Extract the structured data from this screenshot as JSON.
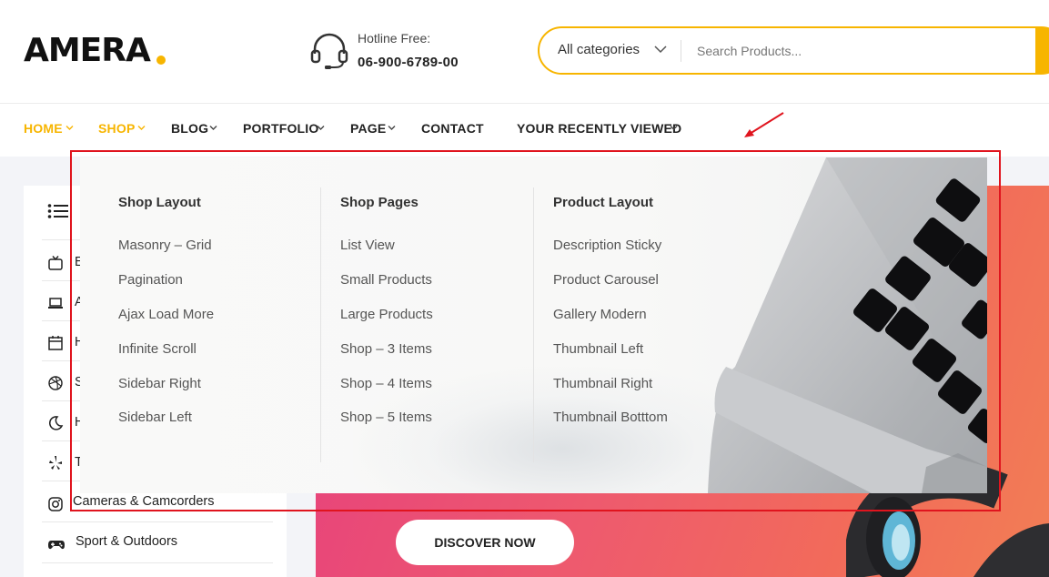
{
  "header": {
    "logo": "AMERA",
    "hotline_label": "Hotline Free:",
    "hotline_number": "06-900-6789-00",
    "category_select": "All categories",
    "search_placeholder": "Search Products..."
  },
  "nav": {
    "items": [
      {
        "label": "HOME",
        "active": true,
        "has_dropdown": true
      },
      {
        "label": "SHOP",
        "active": true,
        "has_dropdown": true
      },
      {
        "label": "BLOG",
        "active": false,
        "has_dropdown": true
      },
      {
        "label": "PORTFOLIO",
        "active": false,
        "has_dropdown": true
      },
      {
        "label": "PAGE",
        "active": false,
        "has_dropdown": true
      },
      {
        "label": "CONTACT",
        "active": false,
        "has_dropdown": false
      },
      {
        "label": "YOUR RECENTLY VIEWED",
        "active": false,
        "has_dropdown": true
      }
    ]
  },
  "sidebar": {
    "items": [
      {
        "label": "E",
        "icon": "tv-icon"
      },
      {
        "label": "A",
        "icon": "laptop-icon"
      },
      {
        "label": "H",
        "icon": "calendar-icon"
      },
      {
        "label": "S",
        "icon": "dribbble-icon"
      },
      {
        "label": "H",
        "icon": "moon-icon"
      },
      {
        "label": "T",
        "icon": "yelp-icon"
      },
      {
        "label": "Cameras & Camcorders",
        "icon": "instagram-icon"
      },
      {
        "label": "Sport & Outdoors",
        "icon": "gamepad-icon"
      }
    ]
  },
  "mega_menu": {
    "columns": [
      {
        "title": "Shop Layout",
        "links": [
          "Masonry – Grid",
          "Pagination",
          "Ajax Load More",
          "Infinite Scroll",
          "Sidebar Right",
          "Sidebar Left"
        ]
      },
      {
        "title": "Shop Pages",
        "links": [
          "List View",
          "Small Products",
          "Large Products",
          "Shop – 3 Items",
          "Shop – 4 Items",
          "Shop – 5 Items"
        ]
      },
      {
        "title": "Product Layout",
        "links": [
          "Description Sticky",
          "Product Carousel",
          "Gallery Modern",
          "Thumbnail Left",
          "Thumbnail Right",
          "Thumbnail Botttom"
        ]
      }
    ]
  },
  "hero": {
    "cta_label": "DISCOVER NOW"
  },
  "colors": {
    "accent": "#f7b500",
    "annotation": "#e0141e",
    "hero_gradient": [
      "#e63e7e",
      "#f27e55"
    ]
  }
}
